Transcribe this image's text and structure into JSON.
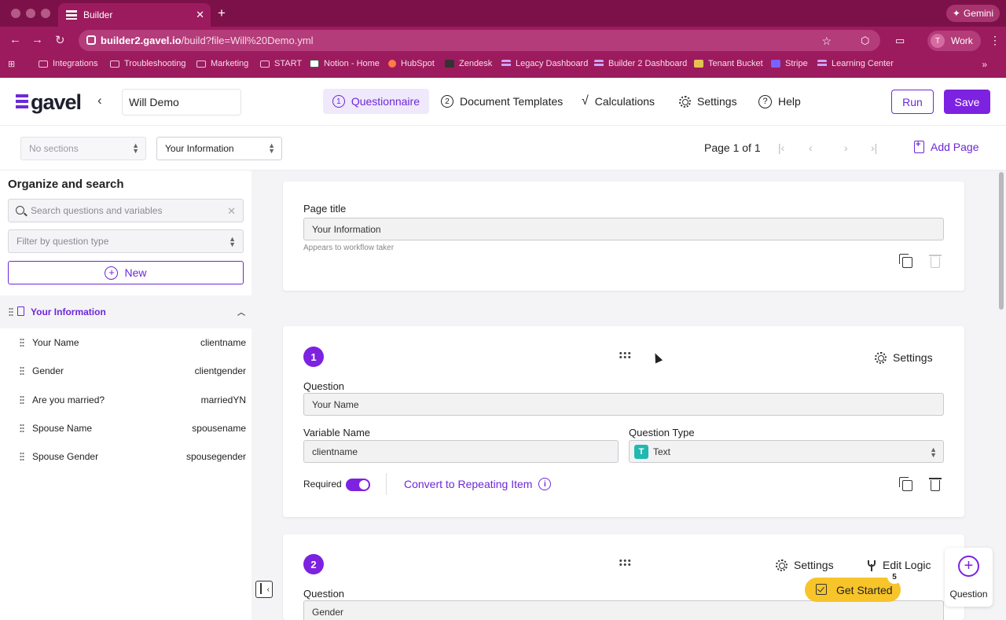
{
  "browser": {
    "tab_title": "Builder",
    "new_tab": "+",
    "gemini_label": "Gemini",
    "url_host": "builder2.gavel.io",
    "url_path": "/build?file=Will%20Demo.yml",
    "profile_initial": "T",
    "profile_label": "Work",
    "bookmarks": [
      "Integrations",
      "Troubleshooting",
      "Marketing",
      "START",
      "Notion - Home",
      "HubSpot",
      "Zendesk",
      "Legacy Dashboard",
      "Builder 2 Dashboard",
      "Tenant Bucket",
      "Stripe",
      "Learning Center"
    ],
    "bookmarks_more": "»"
  },
  "header": {
    "logo_text": "gavel",
    "title_value": "Will Demo",
    "tabs": [
      {
        "num": "1",
        "label": "Questionnaire"
      },
      {
        "num": "2",
        "label": "Document Templates"
      },
      {
        "label": "Calculations"
      },
      {
        "label": "Settings"
      },
      {
        "label": "Help"
      }
    ],
    "run_label": "Run",
    "save_label": "Save"
  },
  "toolbar": {
    "sections_placeholder": "No sections",
    "page_select": "Your Information",
    "page_indicator": "Page 1 of 1",
    "add_page_label": "Add Page"
  },
  "sidebar": {
    "title": "Organize and search",
    "search_placeholder": "Search questions and variables",
    "filter_placeholder": "Filter by question type",
    "new_label": "New",
    "section_label": "Your Information",
    "questions": [
      {
        "label": "Your Name",
        "var": "clientname"
      },
      {
        "label": "Gender",
        "var": "clientgender"
      },
      {
        "label": "Are you married?",
        "var": "marriedYN"
      },
      {
        "label": "Spouse Name",
        "var": "spousename"
      },
      {
        "label": "Spouse Gender",
        "var": "spousegender"
      }
    ]
  },
  "page_card": {
    "title_label": "Page title",
    "title_value": "Your Information",
    "hint": "Appears to workflow taker"
  },
  "question1": {
    "number": "1",
    "settings_label": "Settings",
    "question_label": "Question",
    "question_value": "Your Name",
    "variable_label": "Variable Name",
    "variable_value": "clientname",
    "type_label": "Question Type",
    "type_icon": "T",
    "type_value": "Text",
    "required_label": "Required",
    "required": true,
    "convert_label": "Convert to Repeating Item",
    "info": "i"
  },
  "question2": {
    "number": "2",
    "settings_label": "Settings",
    "logic_label": "Edit Logic",
    "question_label": "Question",
    "question_value": "Gender"
  },
  "floating": {
    "question_label": "Question",
    "get_started_label": "Get Started",
    "get_started_badge": "5"
  },
  "colors": {
    "accent": "#7c22e0",
    "browser": "#9c1b5e",
    "get_started": "#f7c42a",
    "text_type": "#22b8b0"
  }
}
